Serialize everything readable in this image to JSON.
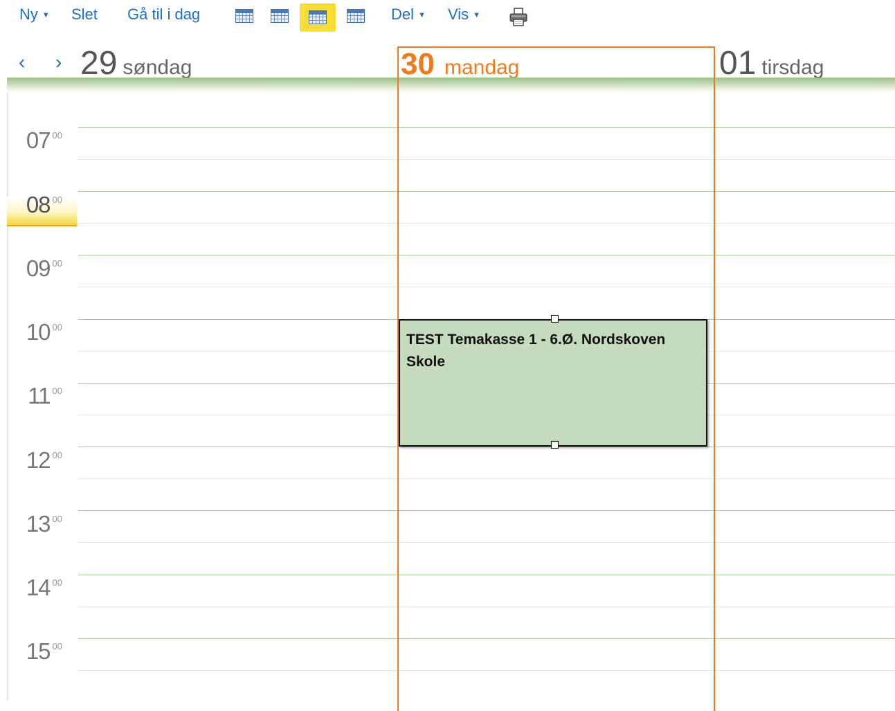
{
  "toolbar": {
    "new_label": "Ny",
    "delete_label": "Slet",
    "goto_today_label": "Gå til i dag",
    "share_label": "Del",
    "view_label": "Vis",
    "view_buttons": [
      {
        "icon": "calendar-day-icon",
        "active": false
      },
      {
        "icon": "calendar-workweek-icon",
        "active": false
      },
      {
        "icon": "calendar-week-icon",
        "active": true
      },
      {
        "icon": "calendar-month-icon",
        "active": false
      }
    ],
    "print_icon": "printer-icon"
  },
  "navigation": {
    "prev": "‹",
    "next": "›"
  },
  "days": [
    {
      "number": "29",
      "name": "søndag",
      "today": false
    },
    {
      "number": "30",
      "name": "mandag",
      "today": true
    },
    {
      "number": "01",
      "name": "tirsdag",
      "today": false
    }
  ],
  "hours": [
    {
      "hour": "07",
      "minutes": "00"
    },
    {
      "hour": "08",
      "minutes": "00",
      "current": true
    },
    {
      "hour": "09",
      "minutes": "00"
    },
    {
      "hour": "10",
      "minutes": "00"
    },
    {
      "hour": "11",
      "minutes": "00"
    },
    {
      "hour": "12",
      "minutes": "00"
    },
    {
      "hour": "13",
      "minutes": "00"
    },
    {
      "hour": "14",
      "minutes": "00"
    },
    {
      "hour": "15",
      "minutes": "00"
    }
  ],
  "event": {
    "title": "TEST Temakasse 1 - 6.Ø. Nordskoven Skole",
    "start": "10:00",
    "end": "12:00",
    "day": "30 mandag"
  },
  "colors": {
    "accent": "#1b6fc8",
    "today": "#f07a1c",
    "event_fill": "#c5dbbd",
    "hour_line": "#a8c898",
    "active_view": "#f7dd36"
  }
}
